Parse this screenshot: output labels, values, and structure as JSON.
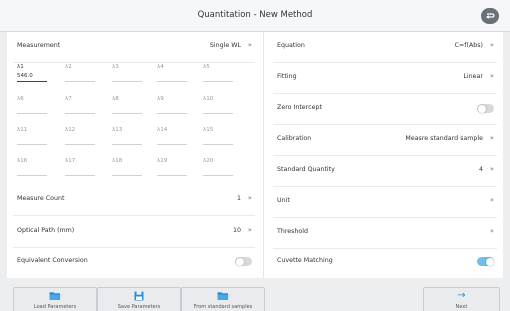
{
  "window": {
    "title": "Quantitation - New Method"
  },
  "measurement": {
    "label": "Measurement",
    "value": "Single WL"
  },
  "wavelengths": [
    {
      "label": "λ1",
      "value": "546.0"
    },
    {
      "label": "λ2",
      "value": ""
    },
    {
      "label": "λ3",
      "value": ""
    },
    {
      "label": "λ4",
      "value": ""
    },
    {
      "label": "λ5",
      "value": ""
    },
    {
      "label": "λ6",
      "value": ""
    },
    {
      "label": "λ7",
      "value": ""
    },
    {
      "label": "λ8",
      "value": ""
    },
    {
      "label": "λ9",
      "value": ""
    },
    {
      "label": "λ10",
      "value": ""
    },
    {
      "label": "λ11",
      "value": ""
    },
    {
      "label": "λ12",
      "value": ""
    },
    {
      "label": "λ13",
      "value": ""
    },
    {
      "label": "λ14",
      "value": ""
    },
    {
      "label": "λ15",
      "value": ""
    },
    {
      "label": "λ16",
      "value": ""
    },
    {
      "label": "λ17",
      "value": ""
    },
    {
      "label": "λ18",
      "value": ""
    },
    {
      "label": "λ19",
      "value": ""
    },
    {
      "label": "λ20",
      "value": ""
    }
  ],
  "measure_count": {
    "label": "Measure Count",
    "value": "1"
  },
  "optical_path": {
    "label": "Optical Path (mm)",
    "value": "10"
  },
  "equivalent_conversion": {
    "label": "Equivalent Conversion",
    "enabled": false
  },
  "equation": {
    "label": "Equation",
    "value": "C=f(Abs)"
  },
  "fitting": {
    "label": "Fitting",
    "value": "Linear"
  },
  "zero_intercept": {
    "label": "Zero Intercept",
    "enabled": false
  },
  "calibration": {
    "label": "Calibration",
    "value": "Measre standard sample"
  },
  "standard_quantity": {
    "label": "Standard Quantity",
    "value": "4"
  },
  "unit": {
    "label": "Unit",
    "value": ""
  },
  "threshold": {
    "label": "Threshold",
    "value": ""
  },
  "cuvette_matching": {
    "label": "Cuvette Matching",
    "enabled": true
  },
  "chevron": "»",
  "toolbar": {
    "load_label": "Load Parameters",
    "save_label": "Save Parameters",
    "from_std_label": "From standard samples",
    "next_label": "Next",
    "next_arrow": "→"
  },
  "colors": {
    "accent": "#2b8ed6",
    "toggle_on": "#6fbfe8",
    "header_button": "#6a7079"
  }
}
